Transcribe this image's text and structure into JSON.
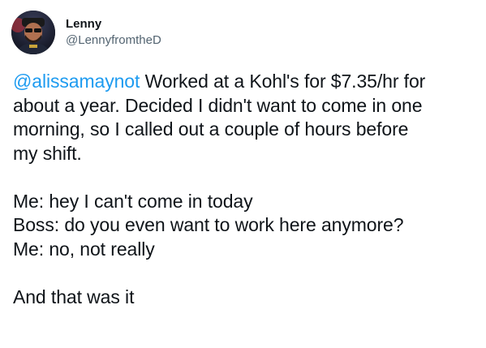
{
  "user": {
    "display_name": "Lenny",
    "handle": "@LennyfromtheD"
  },
  "tweet": {
    "mention": "@alissamaynot",
    "line_1_rest": " Worked at a Kohl's for $7.35/hr for",
    "line_2": "about a year. Decided I didn't want to come in one",
    "line_3": "morning, so I called out a couple of hours before",
    "line_4": "my shift.",
    "dialogue_1": "Me: hey I can't come in today",
    "dialogue_2": "Boss: do you even want to work here anymore?",
    "dialogue_3": "Me: no, not really",
    "closing": "And that was it"
  },
  "colors": {
    "text": "#0f1419",
    "secondary": "#536471",
    "link": "#1d9bf0"
  },
  "icons": {
    "avatar": "profile-photo"
  }
}
